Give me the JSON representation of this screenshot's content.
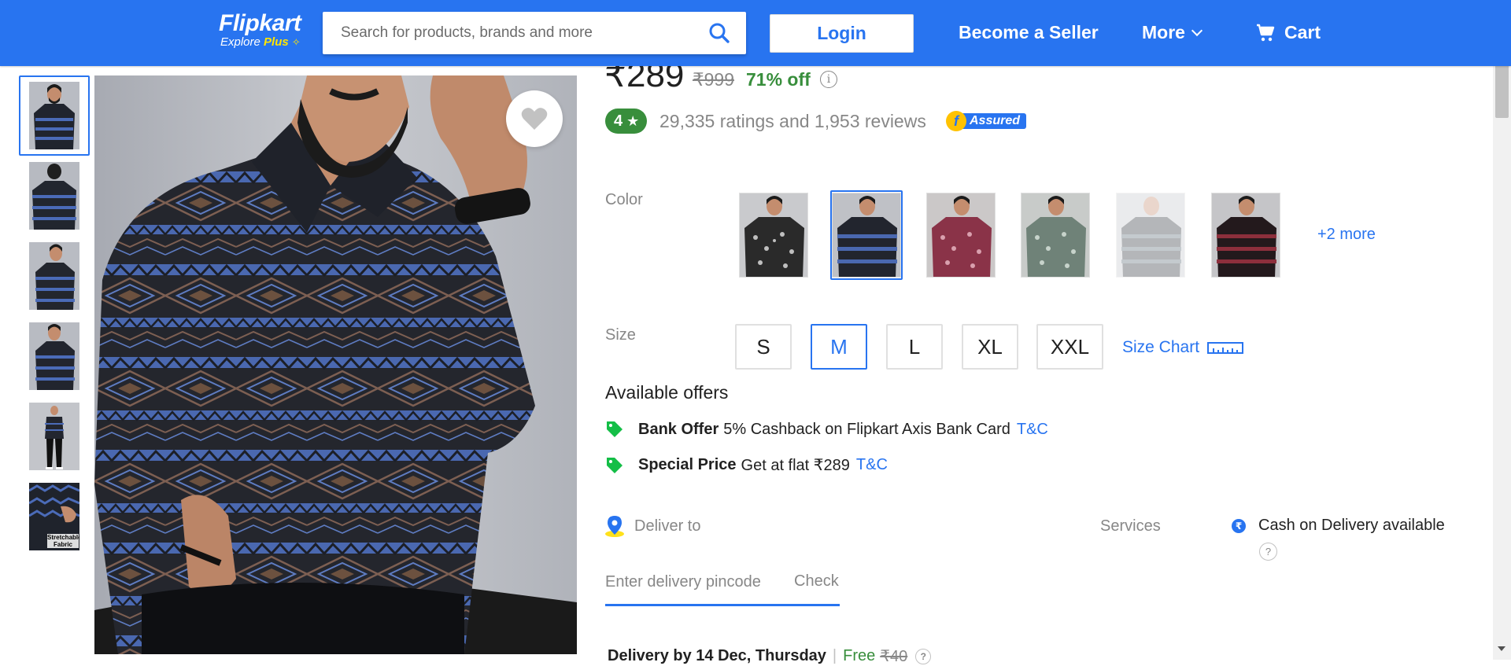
{
  "header": {
    "logo_main": "Flipkart",
    "logo_explore": "Explore",
    "logo_plus": "Plus",
    "search_placeholder": "Search for products, brands and more",
    "login_label": "Login",
    "seller_label": "Become a Seller",
    "more_label": "More",
    "cart_label": "Cart",
    "brand_color": "#2874f0"
  },
  "gallery": {
    "thumbnails": [
      {
        "id": "thumb-1",
        "selected": true
      },
      {
        "id": "thumb-2"
      },
      {
        "id": "thumb-3"
      },
      {
        "id": "thumb-4"
      },
      {
        "id": "thumb-5"
      },
      {
        "id": "thumb-6",
        "label": "Stretchable Fabric"
      }
    ],
    "wishlist_icon": "heart-icon"
  },
  "product": {
    "price": "₹289",
    "mrp": "₹999",
    "discount": "71% off",
    "rating": "4",
    "ratings_text": "29,335 ratings and 1,953 reviews",
    "assured_label": "Assured"
  },
  "color": {
    "label": "Color",
    "more": "+2 more",
    "selected_index": 1
  },
  "size": {
    "label": "Size",
    "options": [
      "S",
      "M",
      "L",
      "XL",
      "XXL"
    ],
    "selected": "M",
    "chart_label": "Size Chart"
  },
  "offers": {
    "title": "Available offers",
    "items": [
      {
        "type": "Bank Offer",
        "desc": "5% Cashback on Flipkart Axis Bank Card",
        "tnc": "T&C"
      },
      {
        "type": "Special Price",
        "desc": "Get at flat ₹289",
        "tnc": "T&C"
      }
    ]
  },
  "delivery": {
    "deliver_to": "Deliver to",
    "pincode_placeholder": "Enter delivery pincode",
    "check_label": "Check",
    "delivery_by": "Delivery by 14 Dec, Thursday",
    "sep": "|",
    "free": "Free",
    "charge": "₹40",
    "help": "?"
  },
  "services": {
    "label": "Services",
    "cod": "Cash on Delivery available",
    "help": "?"
  }
}
